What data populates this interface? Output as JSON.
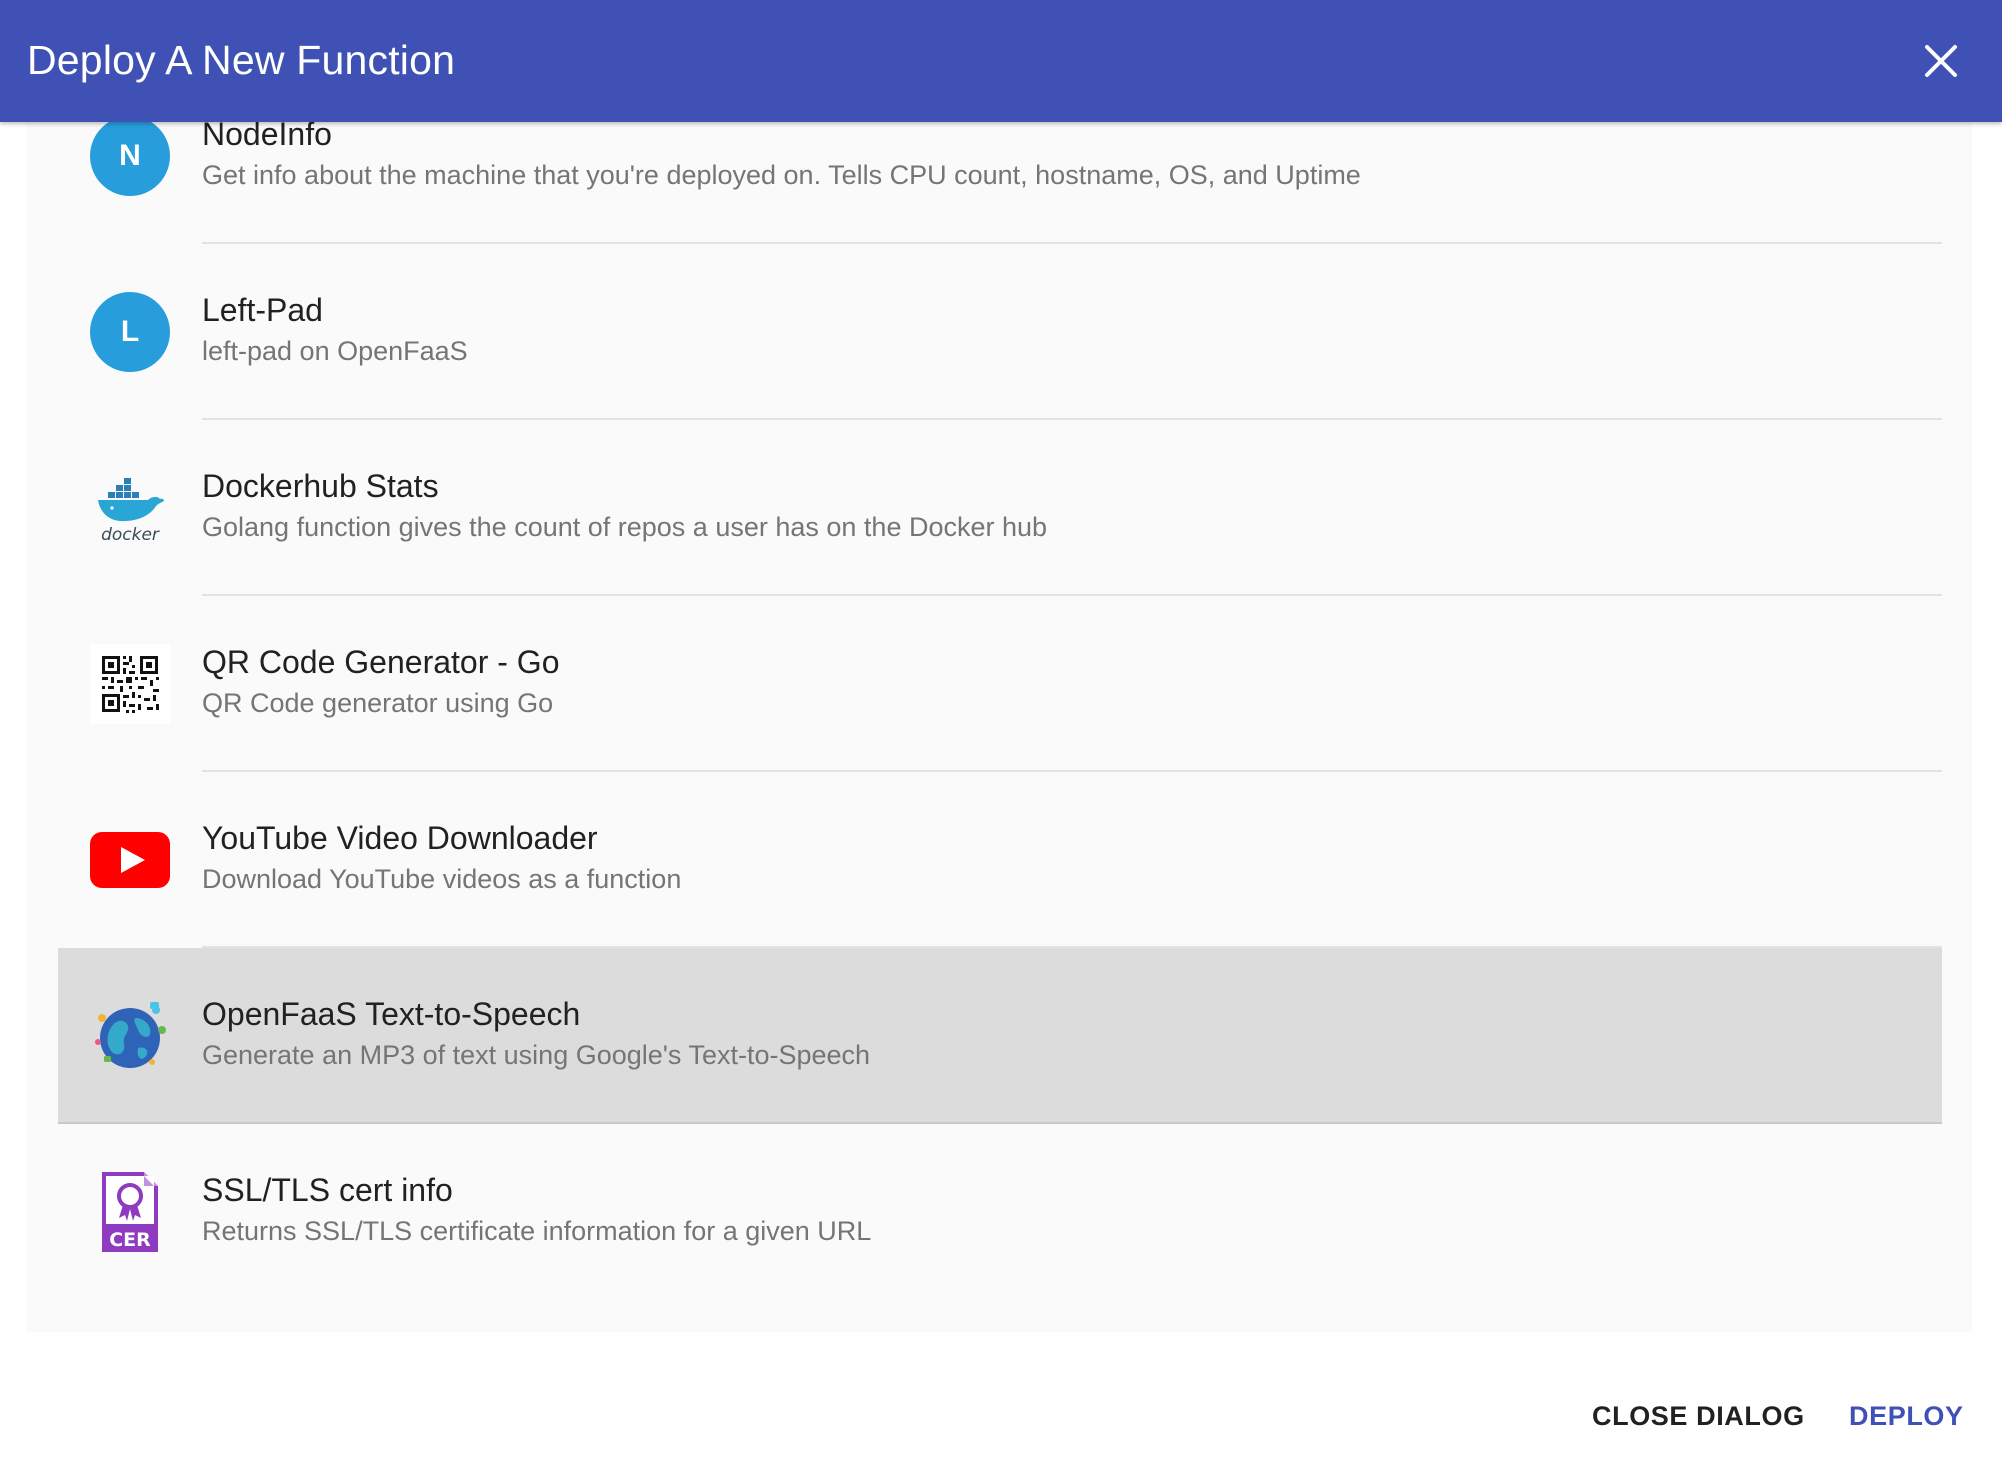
{
  "dialog": {
    "title": "Deploy A New Function",
    "close_icon": "close-icon"
  },
  "functions": [
    {
      "title": "NodeInfo",
      "description": "Get info about the machine that you're deployed on. Tells CPU count, hostname, OS, and Uptime",
      "icon": "avatar",
      "avatar_letter": "N",
      "selected": false
    },
    {
      "title": "Left-Pad",
      "description": "left-pad on OpenFaaS",
      "icon": "avatar",
      "avatar_letter": "L",
      "selected": false
    },
    {
      "title": "Dockerhub Stats",
      "description": "Golang function gives the count of repos a user has on the Docker hub",
      "icon": "docker-logo-icon",
      "logo_text": "docker",
      "selected": false
    },
    {
      "title": "QR Code Generator - Go",
      "description": "QR Code generator using Go",
      "icon": "qr-code-icon",
      "selected": false
    },
    {
      "title": "YouTube Video Downloader",
      "description": "Download YouTube videos as a function",
      "icon": "youtube-icon",
      "selected": false
    },
    {
      "title": "OpenFaaS Text-to-Speech",
      "description": "Generate an MP3 of text using Google's Text-to-Speech",
      "icon": "globe-icon",
      "selected": true
    },
    {
      "title": "SSL/TLS cert info",
      "description": "Returns SSL/TLS certificate information for a given URL",
      "icon": "certificate-icon",
      "logo_text": "CER",
      "selected": false
    }
  ],
  "colors": {
    "primary": "#3f51b5",
    "avatar": "#289ddc",
    "selected_row": "#dcdcdc",
    "youtube_red": "#ff0000",
    "cert_purple": "#8e3bbf"
  },
  "actions": {
    "close_label": "CLOSE DIALOG",
    "deploy_label": "DEPLOY"
  }
}
